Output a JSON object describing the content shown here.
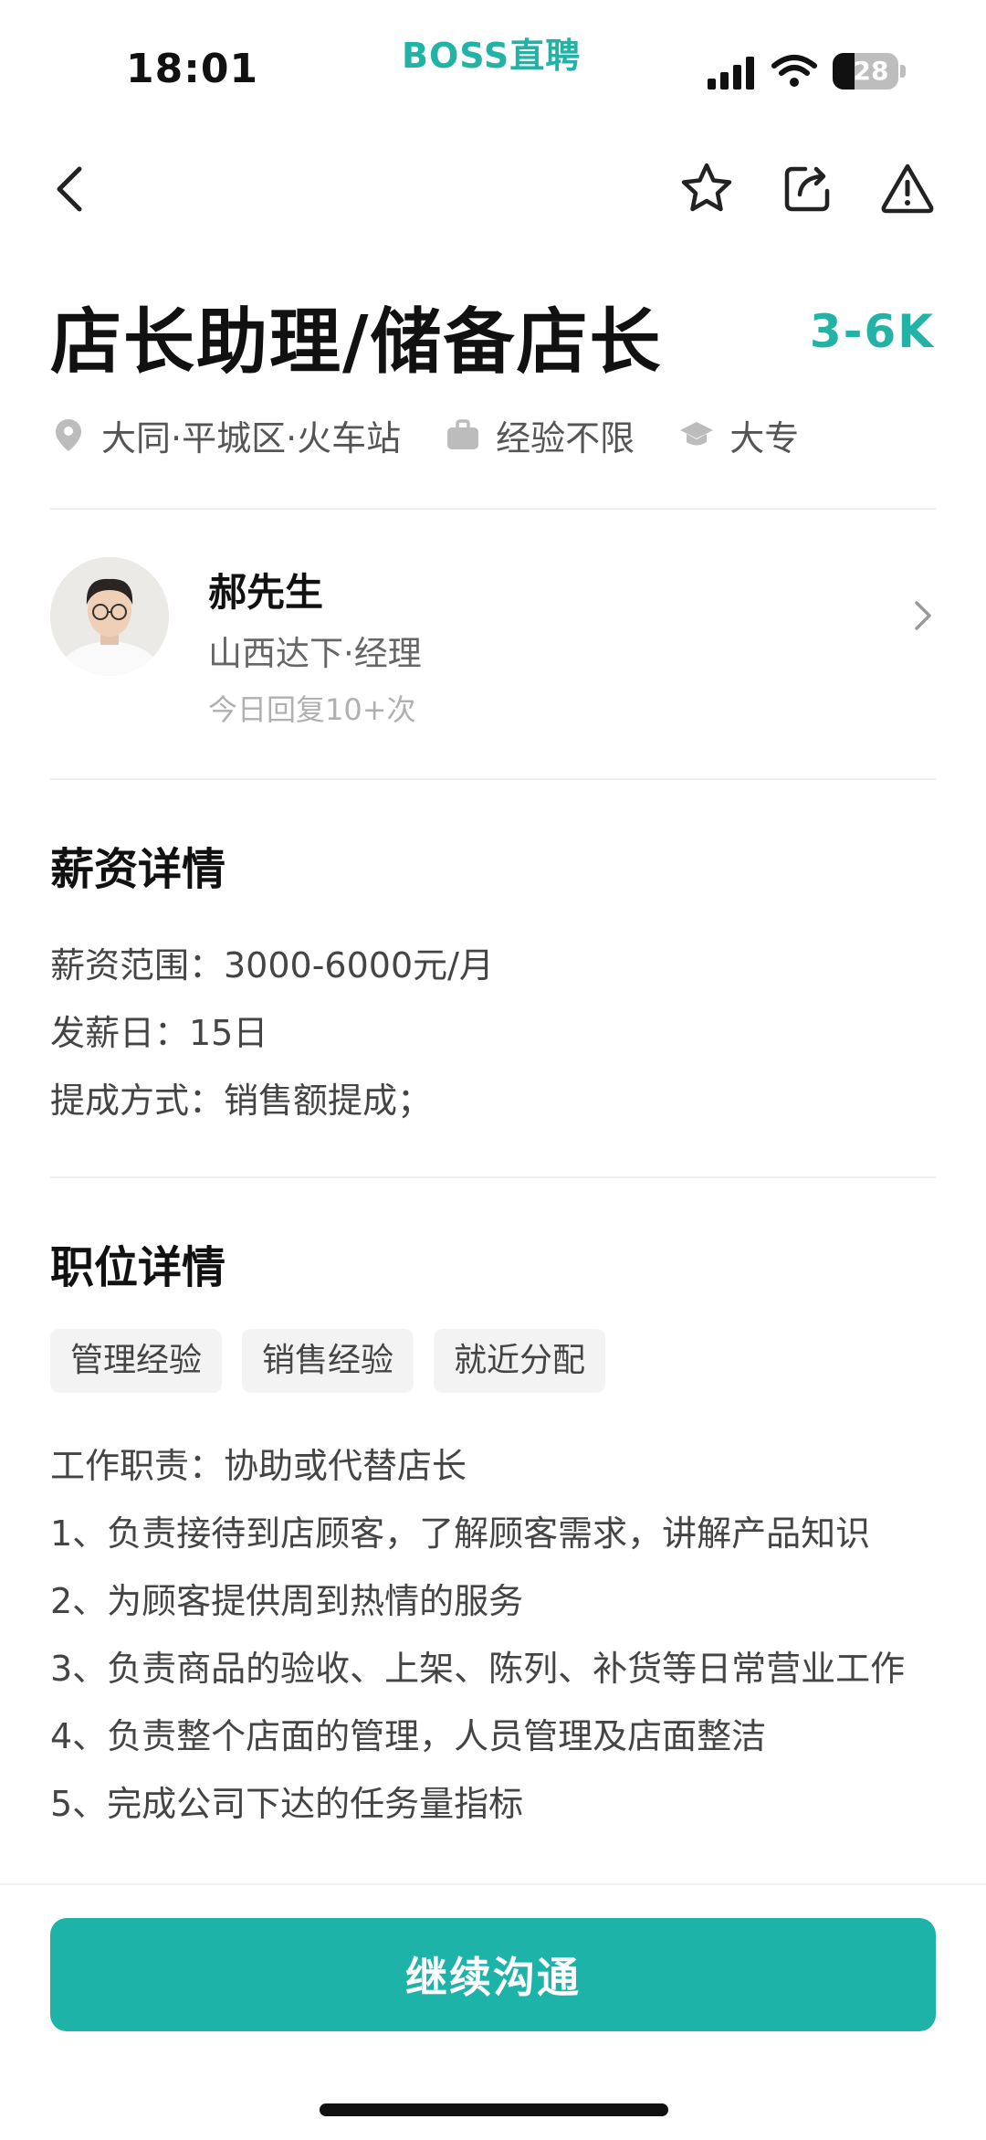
{
  "status_bar": {
    "time": "18:01",
    "brand": "BOSS直聘",
    "battery_level": "28",
    "icons": [
      "signal-icon",
      "wifi-icon",
      "battery-icon"
    ]
  },
  "nav": {
    "icons": [
      "back-icon",
      "star-icon",
      "share-icon",
      "report-icon"
    ]
  },
  "job": {
    "title": "店长助理/储备店长",
    "salary": "3-6K",
    "location": "大同·平城区·火车站",
    "experience": "经验不限",
    "education": "大专"
  },
  "recruiter": {
    "name": "郝先生",
    "company_role": "山西达下·经理",
    "reply_stats": "今日回复10+次"
  },
  "salary_section": {
    "title": "薪资详情",
    "lines": [
      "薪资范围：3000-6000元/月",
      "发薪日：15日",
      "提成方式：销售额提成；"
    ]
  },
  "position_section": {
    "title": "职位详情",
    "tags": [
      "管理经验",
      "销售经验",
      "就近分配"
    ],
    "description": [
      "工作职责：协助或代替店长",
      "1、负责接待到店顾客，了解顾客需求，讲解产品知识",
      "2、为顾客提供周到热情的服务",
      "3、负责商品的验收、上架、陈列、补货等日常营业工作",
      "4、负责整个店面的管理，人员管理及店面整洁",
      "5、完成公司下达的任务量指标"
    ]
  },
  "cta": {
    "label": "继续沟通"
  },
  "colors": {
    "accent": "#22b3a6",
    "button": "#1db3a8"
  }
}
